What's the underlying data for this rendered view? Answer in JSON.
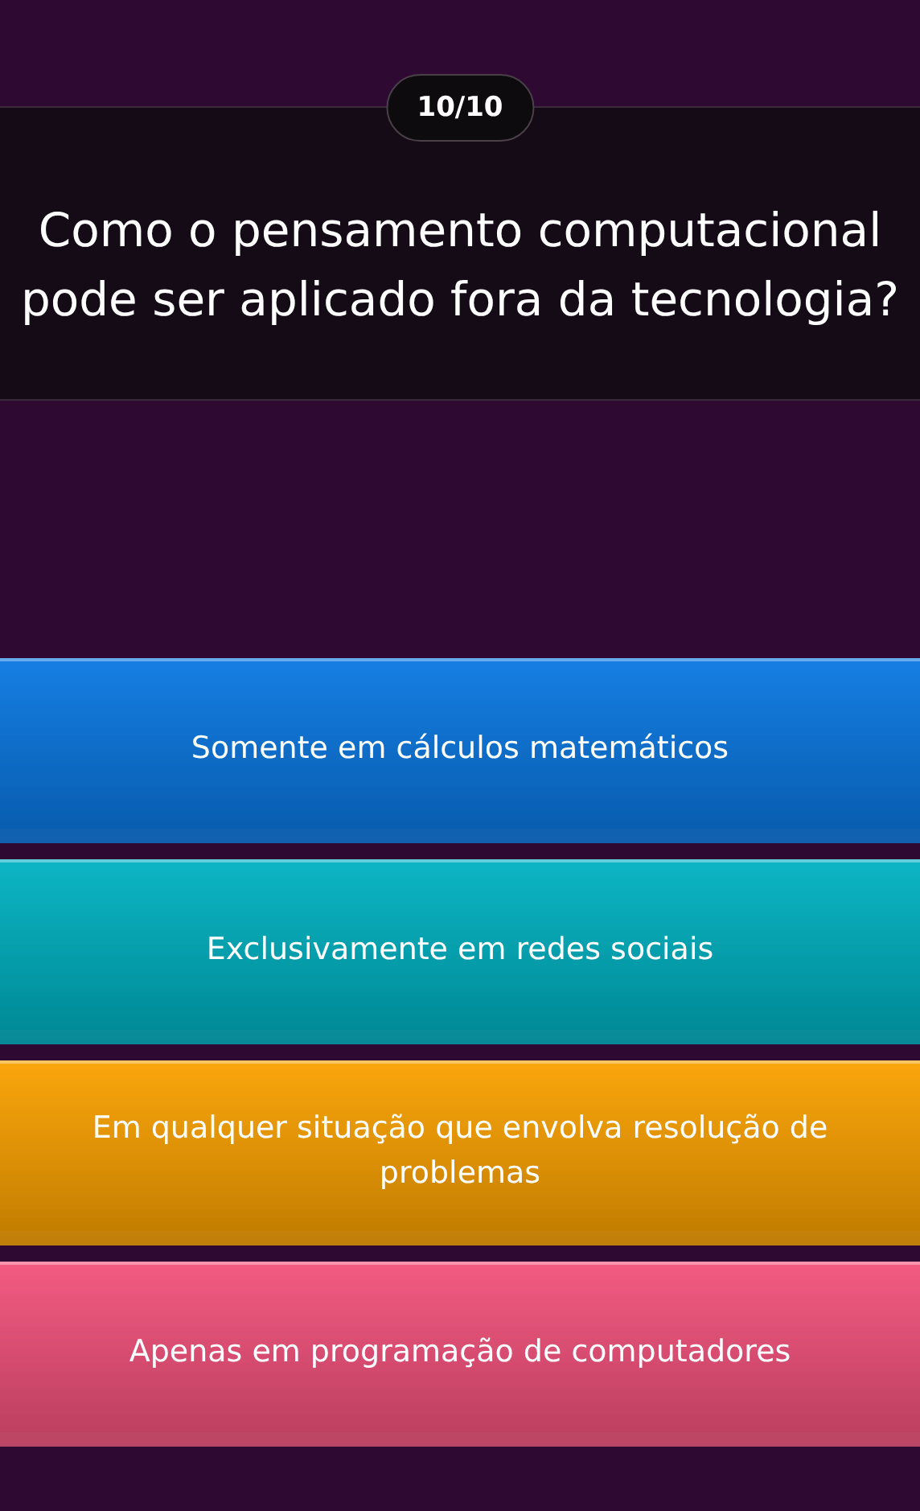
{
  "counter": "10/10",
  "question": "Como o pensamento computacional pode ser aplicado fora da tecnologia?",
  "answers": [
    {
      "label": "Somente em cálculos matemáticos",
      "color": "#0a78e2"
    },
    {
      "label": "Exclusivamente em redes sociais",
      "color": "#00b2c2"
    },
    {
      "label": "Em qualquer situação que envolva resolução de problemas",
      "color": "#fba200"
    },
    {
      "label": "Apenas em programação de computadores",
      "color": "#f3527c"
    }
  ]
}
